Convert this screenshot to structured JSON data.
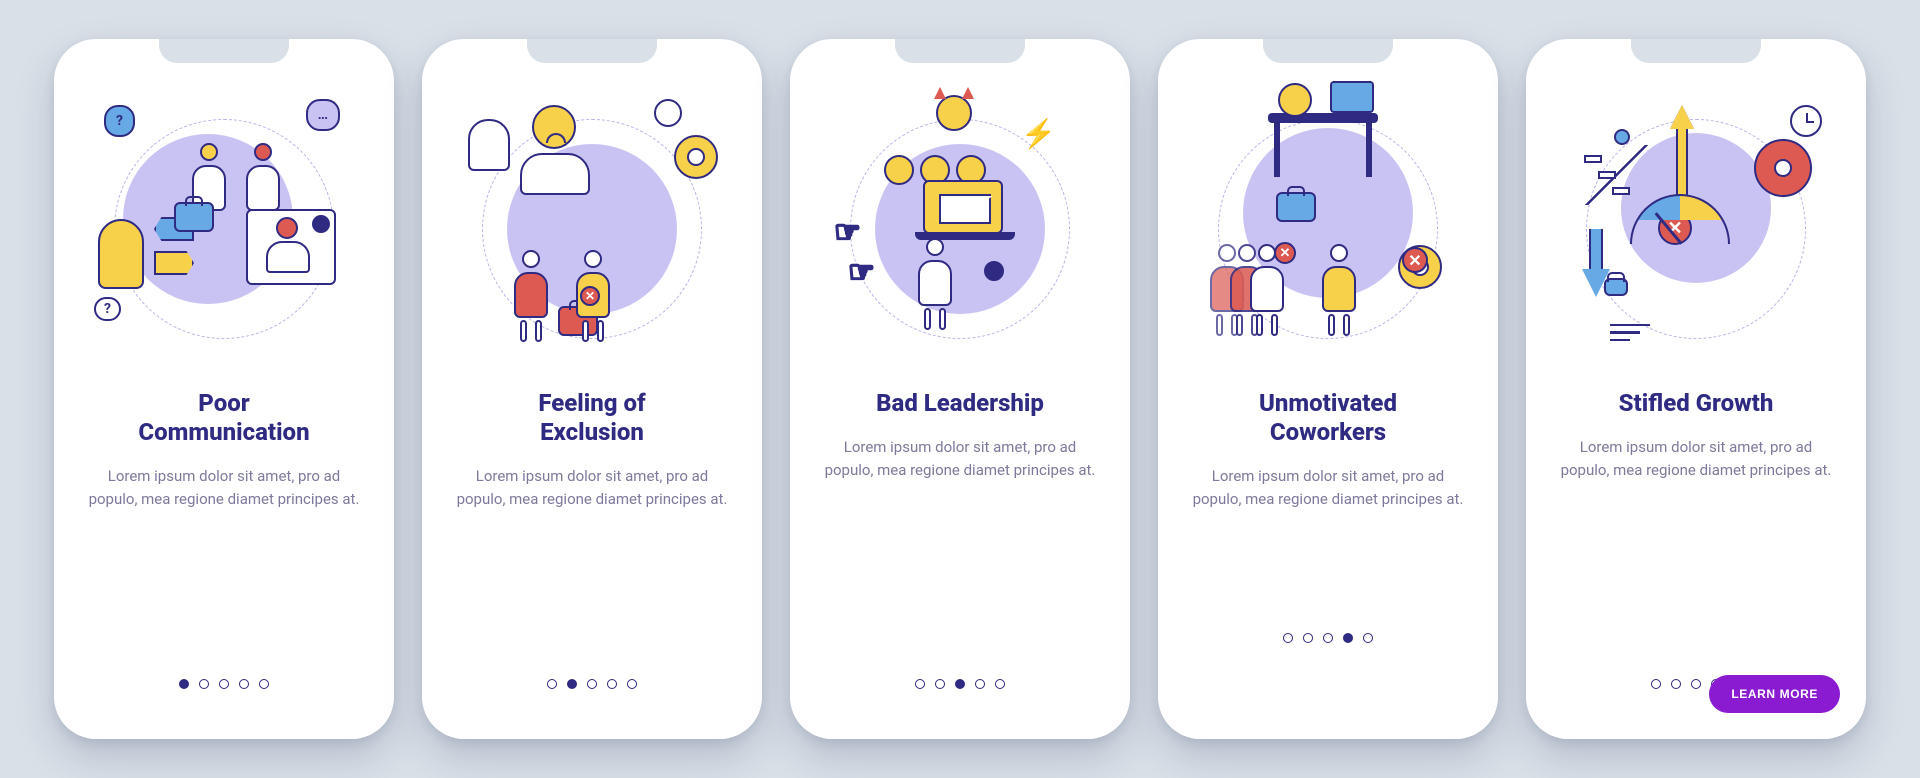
{
  "colors": {
    "accent": "#2f2a82",
    "cta": "#8a1bd1",
    "yellow": "#f7d14a",
    "red": "#dc5a52",
    "blue": "#67a9e4",
    "lilac": "#c9c3f3"
  },
  "slides": [
    {
      "title": "Poor\nCommunication",
      "desc": "Lorem ipsum dolor sit amet, pro ad populo, mea regione diamet principes at.",
      "icons": [
        "speech-bubbles-icon",
        "thought-cloud-icon",
        "person-confused-icon",
        "person-icon",
        "arrow-left-icon",
        "arrow-right-icon",
        "briefcase-icon",
        "moon-icon"
      ],
      "active_dot": 0
    },
    {
      "title": "Feeling of\nExclusion",
      "desc": "Lorem ipsum dolor sit amet, pro ad populo, mea regione diamet principes at.",
      "icons": [
        "stop-hand-icon",
        "sad-person-icon",
        "clock-icon",
        "gear-icon",
        "briefcase-icon",
        "person-red-icon",
        "person-yellow-icon",
        "x-badge-icon"
      ],
      "active_dot": 1
    },
    {
      "title": "Bad Leadership",
      "desc": "Lorem ipsum dolor sit amet, pro ad populo, mea regione diamet principes at.",
      "icons": [
        "devil-boss-icon",
        "lightning-icon",
        "sad-team-icon",
        "pointing-hand-icon",
        "person-icon",
        "briefcase-icon",
        "laptop-icon",
        "envelope-icon",
        "moon-icon"
      ],
      "active_dot": 2
    },
    {
      "title": "Unmotivated\nCoworkers",
      "desc": "Lorem ipsum dolor sit amet, pro ad populo, mea regione diamet principes at.",
      "icons": [
        "sleeping-at-desk-icon",
        "people-group-icon",
        "x-badge-icon",
        "gear-icon",
        "briefcase-icon",
        "person-yellow-icon"
      ],
      "active_dot": 3
    },
    {
      "title": "Stifled Growth",
      "desc": "Lorem ipsum dolor sit amet, pro ad populo, mea regione diamet principes at.",
      "icons": [
        "stairs-icon",
        "arrow-up-icon",
        "gear-icon",
        "clock-icon",
        "x-badge-icon",
        "arrow-down-icon",
        "gauge-icon",
        "briefcase-icon"
      ],
      "active_dot": 4
    }
  ],
  "total_dots": 5,
  "cta_label": "LEARN MORE"
}
